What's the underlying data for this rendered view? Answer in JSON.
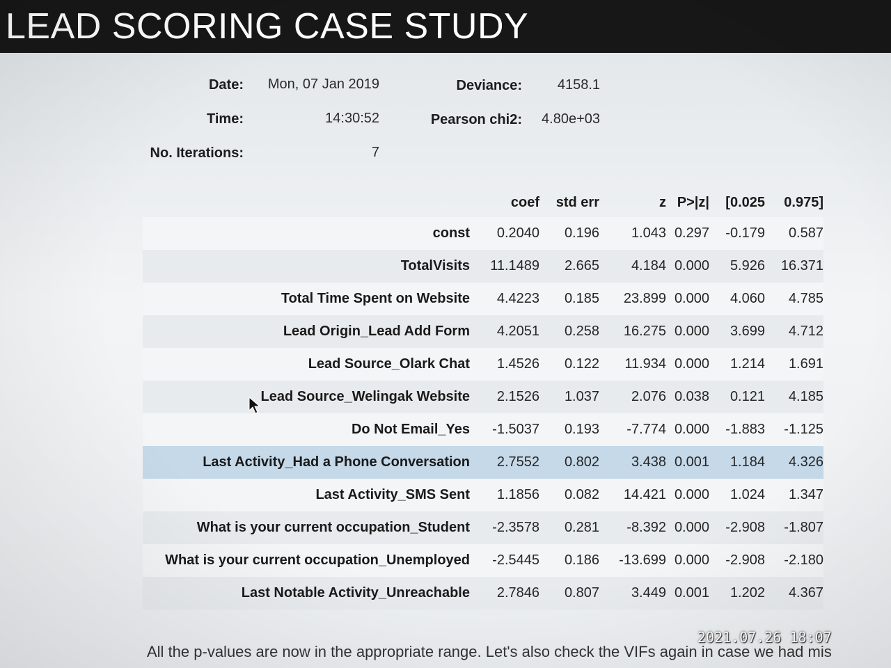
{
  "header": {
    "title": "LEAD SCORING CASE STUDY"
  },
  "summary": {
    "date_label": "Date:",
    "date_value": "Mon, 07 Jan 2019",
    "time_label": "Time:",
    "time_value": "14:30:52",
    "iterations_label": "No. Iterations:",
    "iterations_value": "7",
    "deviance_label": "Deviance:",
    "deviance_value": "4158.1",
    "pearson_label": "Pearson chi2:",
    "pearson_value": "4.80e+03"
  },
  "table": {
    "columns": [
      "coef",
      "std err",
      "z",
      "P>|z|",
      "[0.025",
      "0.975]"
    ],
    "rows": [
      {
        "label": "const",
        "values": [
          "0.2040",
          "0.196",
          "1.043",
          "0.297",
          "-0.179",
          "0.587"
        ]
      },
      {
        "label": "TotalVisits",
        "values": [
          "11.1489",
          "2.665",
          "4.184",
          "0.000",
          "5.926",
          "16.371"
        ]
      },
      {
        "label": "Total Time Spent on Website",
        "values": [
          "4.4223",
          "0.185",
          "23.899",
          "0.000",
          "4.060",
          "4.785"
        ]
      },
      {
        "label": "Lead Origin_Lead Add Form",
        "values": [
          "4.2051",
          "0.258",
          "16.275",
          "0.000",
          "3.699",
          "4.712"
        ]
      },
      {
        "label": "Lead Source_Olark Chat",
        "values": [
          "1.4526",
          "0.122",
          "11.934",
          "0.000",
          "1.214",
          "1.691"
        ]
      },
      {
        "label": "Lead Source_Welingak Website",
        "values": [
          "2.1526",
          "1.037",
          "2.076",
          "0.038",
          "0.121",
          "4.185"
        ]
      },
      {
        "label": "Do Not Email_Yes",
        "values": [
          "-1.5037",
          "0.193",
          "-7.774",
          "0.000",
          "-1.883",
          "-1.125"
        ]
      },
      {
        "label": "Last Activity_Had a Phone Conversation",
        "values": [
          "2.7552",
          "0.802",
          "3.438",
          "0.001",
          "1.184",
          "4.326"
        ]
      },
      {
        "label": "Last Activity_SMS Sent",
        "values": [
          "1.1856",
          "0.082",
          "14.421",
          "0.000",
          "1.024",
          "1.347"
        ]
      },
      {
        "label": "What is your current occupation_Student",
        "values": [
          "-2.3578",
          "0.281",
          "-8.392",
          "0.000",
          "-2.908",
          "-1.807"
        ]
      },
      {
        "label": "What is your current occupation_Unemployed",
        "values": [
          "-2.5445",
          "0.186",
          "-13.699",
          "0.000",
          "-2.908",
          "-2.180"
        ]
      },
      {
        "label": "Last Notable Activity_Unreachable",
        "values": [
          "2.7846",
          "0.807",
          "3.449",
          "0.001",
          "1.202",
          "4.367"
        ]
      }
    ]
  },
  "footer": {
    "text": "All the p-values are now in the appropriate range. Let's also check the VIFs again in case we had mis",
    "timestamp": "2021.07.26 18:07"
  },
  "colors": {
    "title_bar": "#171717",
    "highlight_row": "#c5d9e8"
  }
}
